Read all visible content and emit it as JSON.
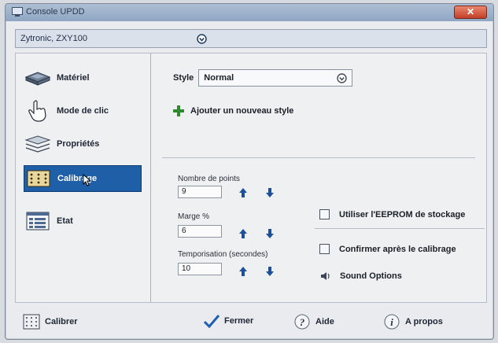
{
  "window": {
    "title": "Console UPDD",
    "close_label": "✕"
  },
  "device": {
    "selected": "Zytronic, ZXY100"
  },
  "sidebar": {
    "items": [
      {
        "label": "Matériel",
        "icon": "hardware-icon"
      },
      {
        "label": "Mode de clic",
        "icon": "hand-pointer-icon"
      },
      {
        "label": "Propriétés",
        "icon": "layers-icon"
      },
      {
        "label": "Calibrage",
        "icon": "calibration-grid-icon",
        "active": true
      },
      {
        "label": "Etat",
        "icon": "status-window-icon"
      }
    ]
  },
  "style": {
    "label": "Style",
    "value": "Normal",
    "add_label": "Ajouter un nouveau style"
  },
  "calibration": {
    "points_label": "Nombre de points",
    "points_value": "9",
    "margin_label": "Marge %",
    "margin_value": "6",
    "timeout_label": "Temporisation (secondes)",
    "timeout_value": "10"
  },
  "options": {
    "eeprom_label": "Utiliser l'EEPROM de stockage",
    "confirm_label": "Confirmer après le calibrage",
    "sound_label": "Sound Options"
  },
  "footer": {
    "calibrate_label": "Calibrer",
    "close_label": "Fermer",
    "help_label": "Aide",
    "about_label": "A propos"
  },
  "colors": {
    "accent": "#1e5fa8",
    "arrow": "#1d4f9c",
    "add": "#2f8a2f"
  }
}
